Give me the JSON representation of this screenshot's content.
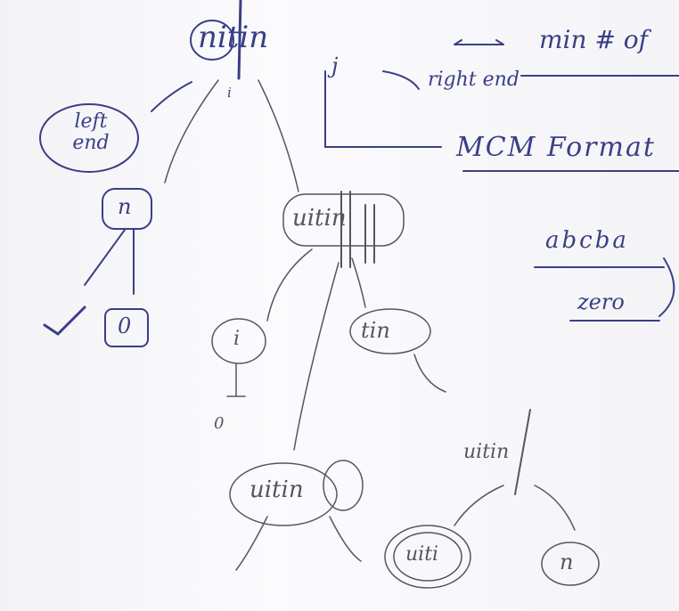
{
  "root": {
    "word": "nitin",
    "i_marker": "i",
    "j_marker": "j"
  },
  "notes": {
    "min_ops": "min # of",
    "right_end": "right end",
    "mcm": "MCM Format",
    "left_end": "left end",
    "example": "abcba",
    "example_result": "zero"
  },
  "left_branch": {
    "node": "n",
    "leaf": "0"
  },
  "middle": {
    "node": "uitin",
    "left_child": "i",
    "left_leaf": "0",
    "right_child": "tin"
  },
  "bottom_left": {
    "node": "uitin"
  },
  "bottom_right": {
    "node": "uitin",
    "left_child": "uiti",
    "right_child": "n"
  },
  "colors": {
    "ink_blue": "#3a3f86",
    "ink_grey": "#55565e"
  }
}
